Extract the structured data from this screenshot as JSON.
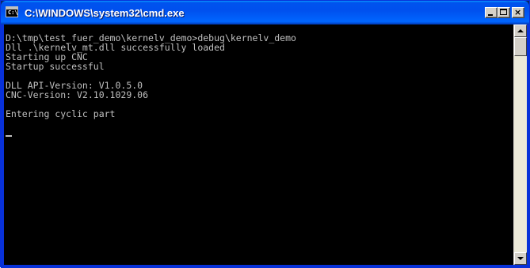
{
  "window": {
    "title": "C:\\WINDOWS\\system32\\cmd.exe",
    "icon": "cmd-app-icon",
    "icon_glyph": "C:\\",
    "buttons": {
      "minimize": "minimize-icon",
      "maximize": "maximize-icon",
      "close": "close-icon",
      "close_glyph": "×"
    }
  },
  "console": {
    "background": "#000000",
    "foreground": "#c0c0c0",
    "lines": [
      "D:\\tmp\\test_fuer_demo\\kernelv_demo>debug\\kernelv_demo",
      "Dll .\\kernelv_mt.dll successfully loaded",
      "Starting up CNC",
      "Startup successful",
      "",
      "DLL API-Version: V1.0.5.0",
      "CNC-Version: V2.10.1029.06",
      "",
      "Entering cyclic part"
    ]
  },
  "colors": {
    "titlebar": "#0053ee",
    "frame": "#0831d9"
  }
}
